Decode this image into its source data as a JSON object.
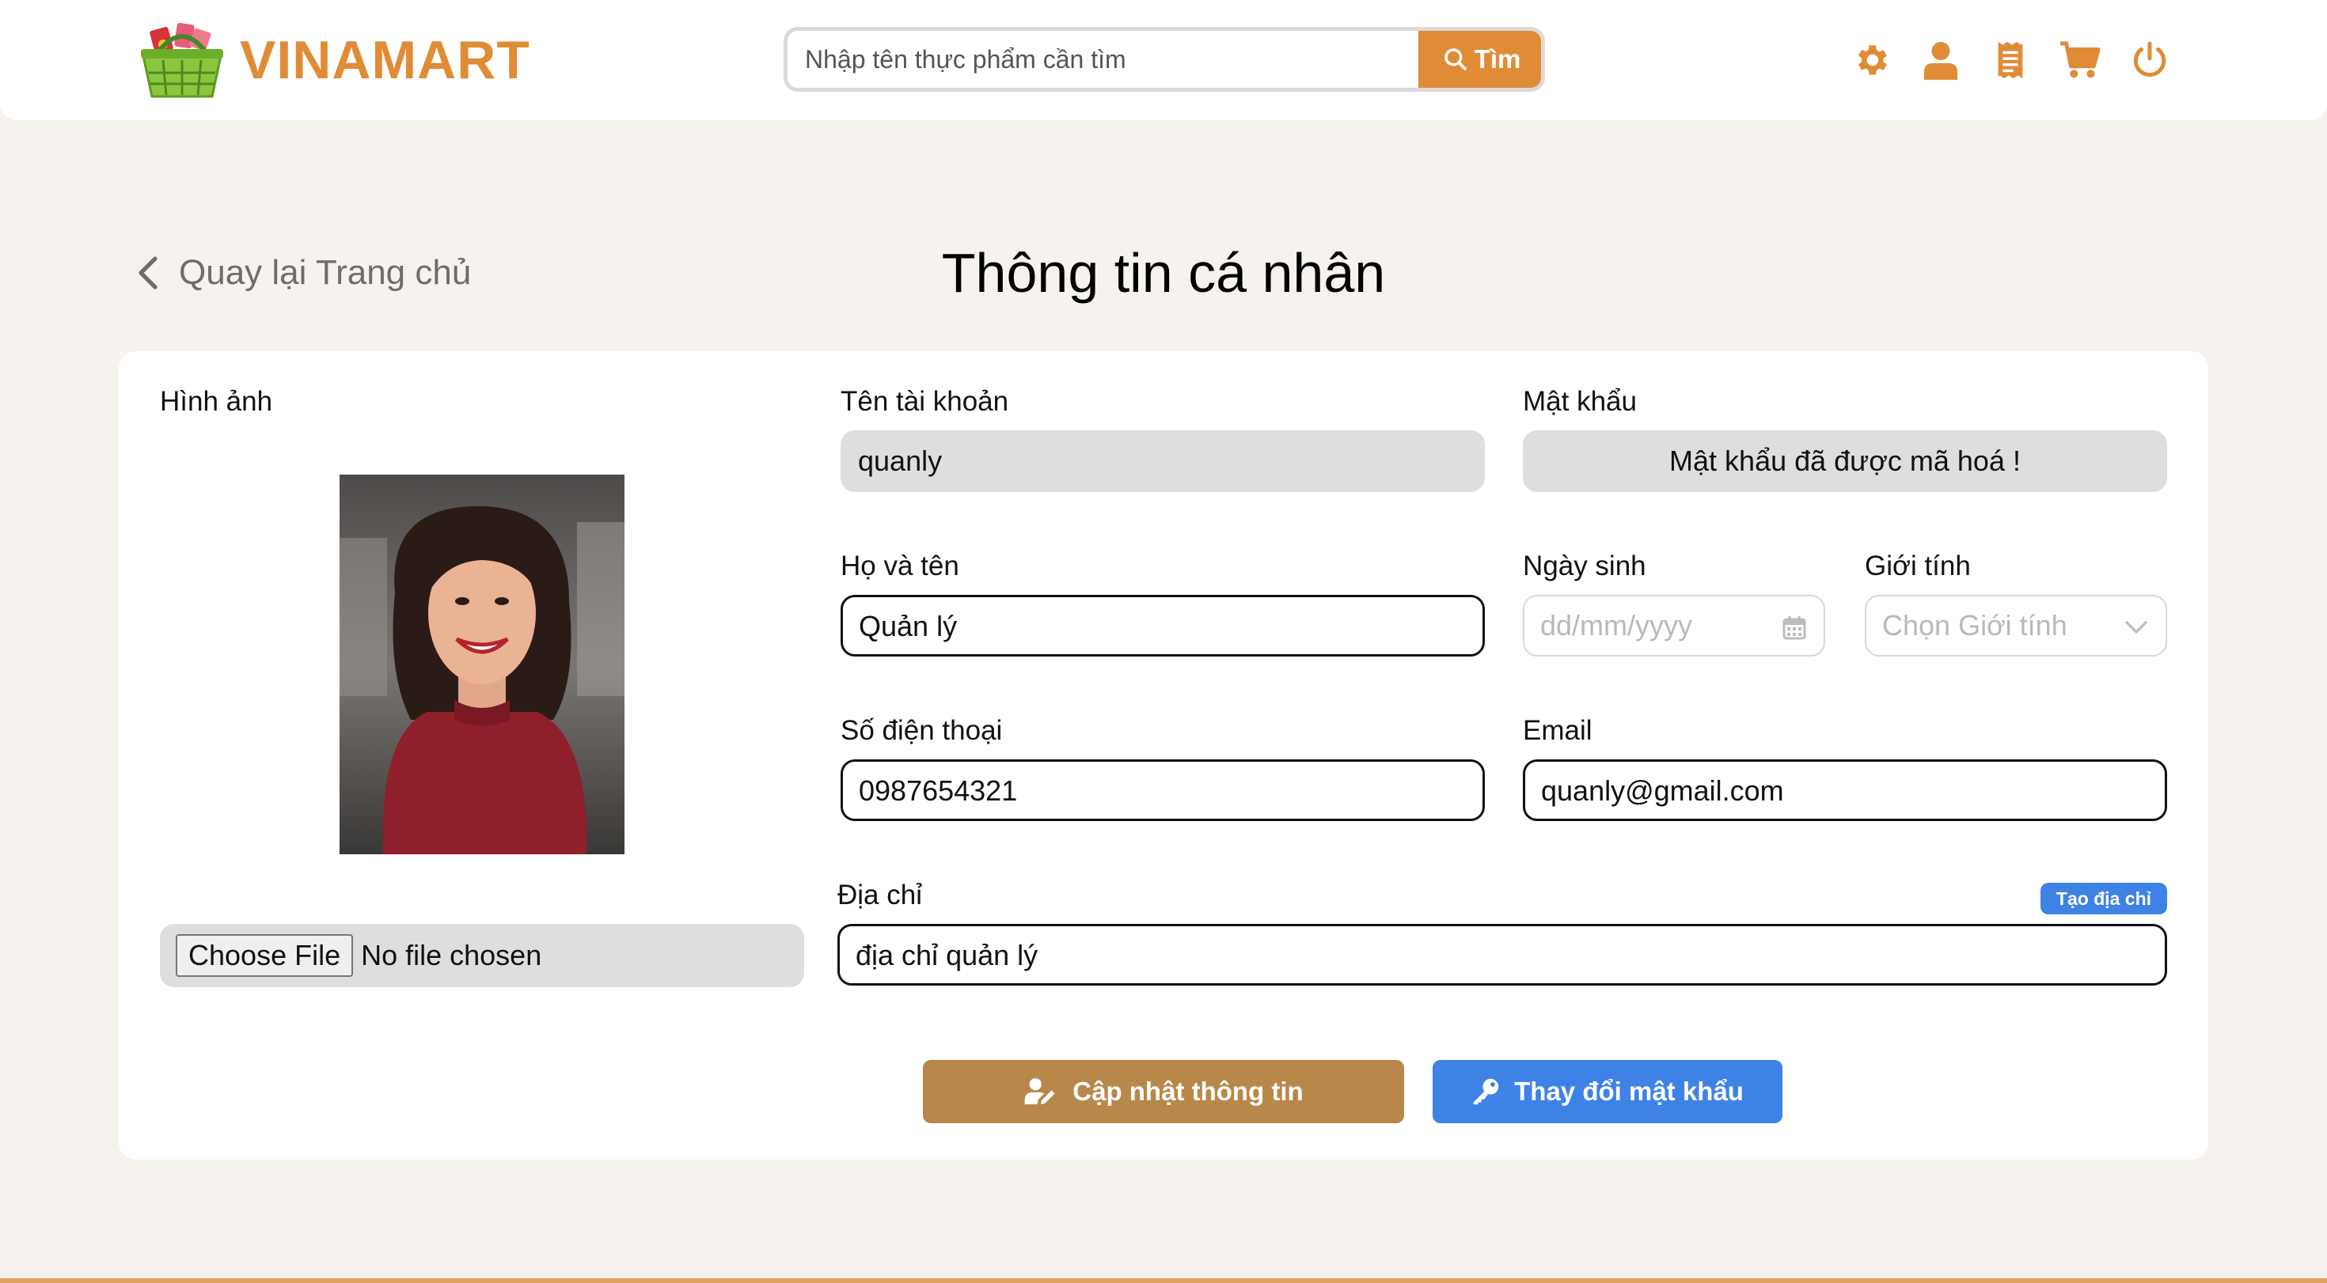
{
  "brand": {
    "name": "VINAMART",
    "accent": "#e08c36"
  },
  "search": {
    "placeholder": "Nhập tên thực phẩm cần tìm",
    "button_label": "Tìm"
  },
  "header_icons": [
    "gear-icon",
    "user-icon",
    "receipt-icon",
    "cart-icon",
    "power-icon"
  ],
  "nav": {
    "back_label": "Quay lại Trang chủ"
  },
  "page": {
    "title": "Thông tin cá nhân"
  },
  "form": {
    "image": {
      "label": "Hình ảnh",
      "choose_file": "Choose File",
      "no_file": "No file chosen"
    },
    "username": {
      "label": "Tên tài khoản",
      "value": "quanly"
    },
    "password": {
      "label": "Mật khẩu",
      "value": "Mật khẩu đã được mã hoá !"
    },
    "fullname": {
      "label": "Họ và tên",
      "value": "Quản lý"
    },
    "birthday": {
      "label": "Ngày sinh",
      "placeholder": "dd/mm/yyyy"
    },
    "gender": {
      "label": "Giới tính",
      "placeholder": "Chọn Giới tính"
    },
    "phone": {
      "label": "Số điện thoại",
      "value": "0987654321"
    },
    "email": {
      "label": "Email",
      "value": "quanly@gmail.com"
    },
    "address": {
      "label": "Địa chỉ",
      "value": "địa chỉ quản lý",
      "create_label": "Tạo địa chỉ"
    }
  },
  "actions": {
    "update_label": "Cập nhật thông tin",
    "change_password_label": "Thay đổi mật khẩu"
  },
  "colors": {
    "accent": "#e08c36",
    "update_button": "#b8874a",
    "blue": "#3e82e6",
    "background": "#f6f3ef"
  }
}
